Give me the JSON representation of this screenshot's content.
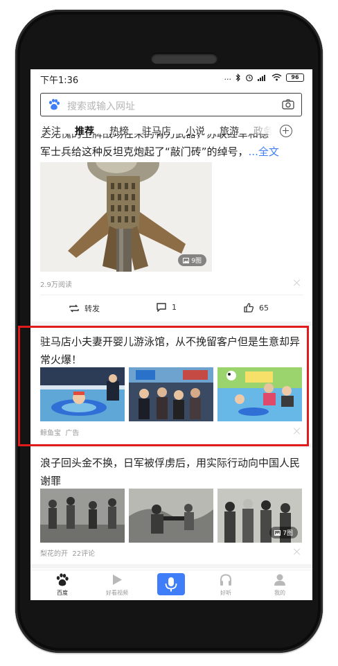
{
  "status_bar": {
    "time": "下午1:36",
    "signal": "...",
    "battery": "96"
  },
  "search": {
    "placeholder": "搜索或输入网址"
  },
  "tabs": [
    {
      "label": "关注",
      "active": false
    },
    {
      "label": "推荐",
      "active": true
    },
    {
      "label": "热榜",
      "active": false
    },
    {
      "label": "驻马店",
      "active": false
    },
    {
      "label": "小说",
      "active": false
    },
    {
      "label": "旅游",
      "active": false
    },
    {
      "label": "政务",
      "active": false
    }
  ],
  "article1": {
    "text_partial": "...军士兵给这种反坦克炮起了“敲门砖”的绰号，",
    "text_line2": "军士兵给这种反坦克炮起了“敲门砖”的绰号，",
    "more": "...全文",
    "image_count": "9图",
    "reads": "2.9万阅读",
    "actions": {
      "share": "转发",
      "comments": "1",
      "likes": "65"
    }
  },
  "ad": {
    "title": "驻马店小夫妻开婴儿游泳馆，从不挽留客户但是生意却异常火爆！",
    "source": "鲸鱼宝",
    "tag": "广告"
  },
  "article3": {
    "title": "浪子回头金不换，日军被俘虏后，用实际行动向中国人民谢罪",
    "source": "梨花的开",
    "comments": "22评论",
    "image_count": "7图"
  },
  "bottom_nav": [
    {
      "label": "百度",
      "active": true
    },
    {
      "label": "好看视频",
      "active": false
    },
    {
      "label": "",
      "active": false
    },
    {
      "label": "好听",
      "active": false
    },
    {
      "label": "我的",
      "active": false
    }
  ],
  "colors": {
    "accent": "#3f7ef8",
    "highlight": "#e11b1b"
  }
}
